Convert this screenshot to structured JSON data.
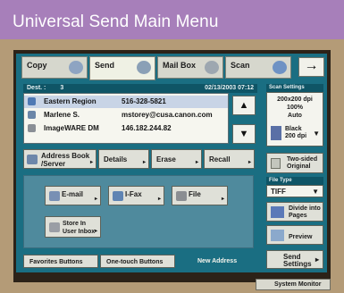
{
  "caption": "Universal Send Main Menu",
  "tabs": [
    {
      "label": "Copy",
      "icon": "copy-icon"
    },
    {
      "label": "Send",
      "icon": "send-icon"
    },
    {
      "label": "Mail Box",
      "icon": "mailbox-icon"
    },
    {
      "label": "Scan",
      "icon": "scan-icon"
    }
  ],
  "tab_arrow": "→",
  "dest_header": {
    "label": "Dest. :",
    "count": "3",
    "datetime": "02/13/2003 07:12"
  },
  "destinations": [
    {
      "name": "Eastern Region",
      "address": "516-328-5821",
      "icon": "fax-icon"
    },
    {
      "name": "Marlene S.",
      "address": "mstorey@cusa.canon.com",
      "icon": "email-icon"
    },
    {
      "name": "ImageWARE DM",
      "address": "146.182.244.82",
      "icon": "file-server-icon"
    }
  ],
  "scroll": {
    "up": "▲",
    "down": "▼"
  },
  "actions": {
    "address_book": "Address Book /Server",
    "details": "Details",
    "erase": "Erase",
    "recall": "Recall"
  },
  "send_types": {
    "email": "E-mail",
    "ifax": "I-Fax",
    "file": "File",
    "user_inbox": "Store In User Inbox"
  },
  "bottom": {
    "favorites": "Favorites Buttons",
    "one_touch": "One-touch Buttons",
    "new_address": "New Address"
  },
  "scan_settings": {
    "header": "Scan Settings",
    "resolution": "200x200 dpi",
    "ratio": "100%",
    "density": "Auto",
    "mode": "Black",
    "mode_dpi": "200 dpi"
  },
  "two_sided": "Two-sided Original",
  "file_type": {
    "header": "File Type",
    "value": "TIFF"
  },
  "divide_pages": "Divide into Pages",
  "preview": "Preview",
  "send_settings": "Send Settings",
  "system_monitor": "System Monitor",
  "tri": "▸",
  "dropdown": "▼",
  "colors": {
    "screen_teal": "#1a6e82",
    "header_teal": "#0f5566",
    "caption_purple": "#a77fba"
  }
}
